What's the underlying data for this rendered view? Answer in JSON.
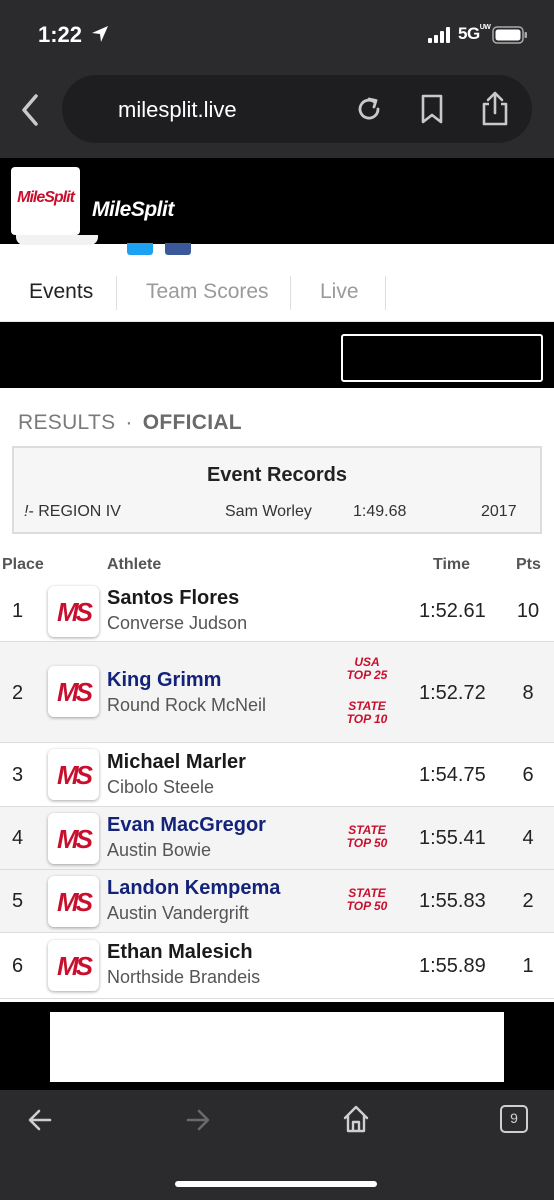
{
  "status": {
    "time": "1:22",
    "network": "5G",
    "network_sub": "UW"
  },
  "browser": {
    "url": "milesplit.live",
    "tab_count": "9"
  },
  "site": {
    "logo_text": "MileSplit",
    "brand": "MileSplit"
  },
  "tabs": [
    {
      "label": "Events",
      "active": true
    },
    {
      "label": "Team Scores",
      "active": false
    },
    {
      "label": "Live",
      "active": false
    }
  ],
  "results": {
    "label": "RESULTS",
    "separator": "·",
    "status": "OFFICIAL"
  },
  "records": {
    "title": "Event Records",
    "row": {
      "mark": "!",
      "name": "- REGION IV",
      "athlete": "Sam Worley",
      "time": "1:49.68",
      "year": "2017"
    }
  },
  "columns": {
    "place": "Place",
    "athlete": "Athlete",
    "time": "Time",
    "pts": "Pts"
  },
  "logo_text": "MS",
  "rows": [
    {
      "place": "1",
      "name": "Santos Flores",
      "school": "Converse Judson",
      "time": "1:52.61",
      "pts": "10",
      "badges": []
    },
    {
      "place": "2",
      "name": "King Grimm",
      "school": "Round Rock McNeil",
      "time": "1:52.72",
      "pts": "8",
      "badges": [
        {
          "line1": "USA",
          "line2": "TOP 25"
        },
        {
          "line1": "STATE",
          "line2": "TOP 10"
        }
      ]
    },
    {
      "place": "3",
      "name": "Michael Marler",
      "school": "Cibolo Steele",
      "time": "1:54.75",
      "pts": "6",
      "badges": []
    },
    {
      "place": "4",
      "name": "Evan MacGregor",
      "school": "Austin Bowie",
      "time": "1:55.41",
      "pts": "4",
      "badges": [
        {
          "line1": "STATE",
          "line2": "TOP 50"
        }
      ]
    },
    {
      "place": "5",
      "name": "Landon Kempema",
      "school": "Austin Vandergrift",
      "time": "1:55.83",
      "pts": "2",
      "badges": [
        {
          "line1": "STATE",
          "line2": "TOP 50"
        }
      ]
    },
    {
      "place": "6",
      "name": "Ethan Malesich",
      "school": "Northside Brandeis",
      "time": "1:55.89",
      "pts": "1",
      "badges": []
    }
  ],
  "colors": {
    "brand_red": "#c8102e",
    "brand_navy": "#14237a",
    "chrome": "#2b2b2d"
  }
}
